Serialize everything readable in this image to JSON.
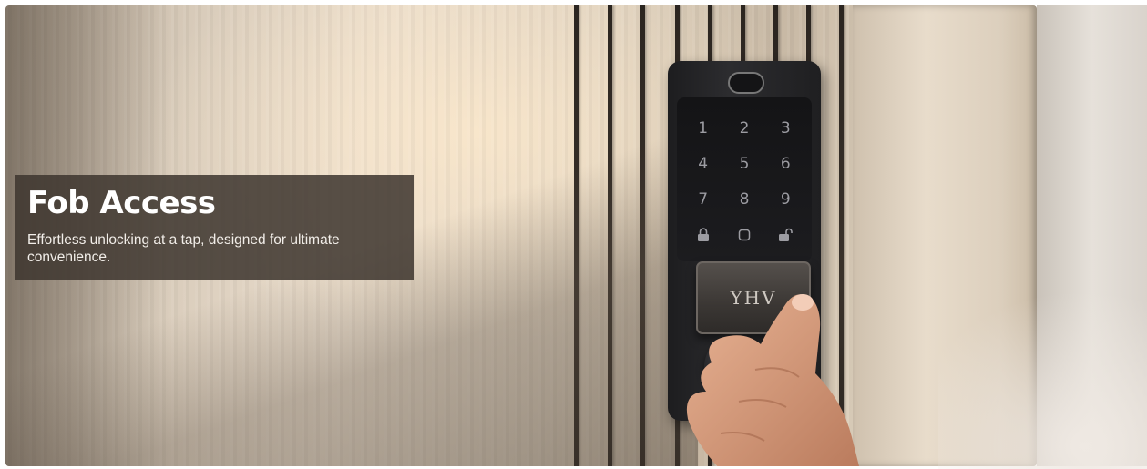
{
  "banner": {
    "title": "Fob Access",
    "subtitle": "Effortless unlocking at a tap, designed for ultimate convenience.",
    "caption_bg": "#3e362f"
  },
  "lock": {
    "keys": [
      "1",
      "2",
      "3",
      "4",
      "5",
      "6",
      "7",
      "8",
      "9",
      "🔒",
      "▢",
      "🔓"
    ],
    "fob_text": "YHV"
  }
}
